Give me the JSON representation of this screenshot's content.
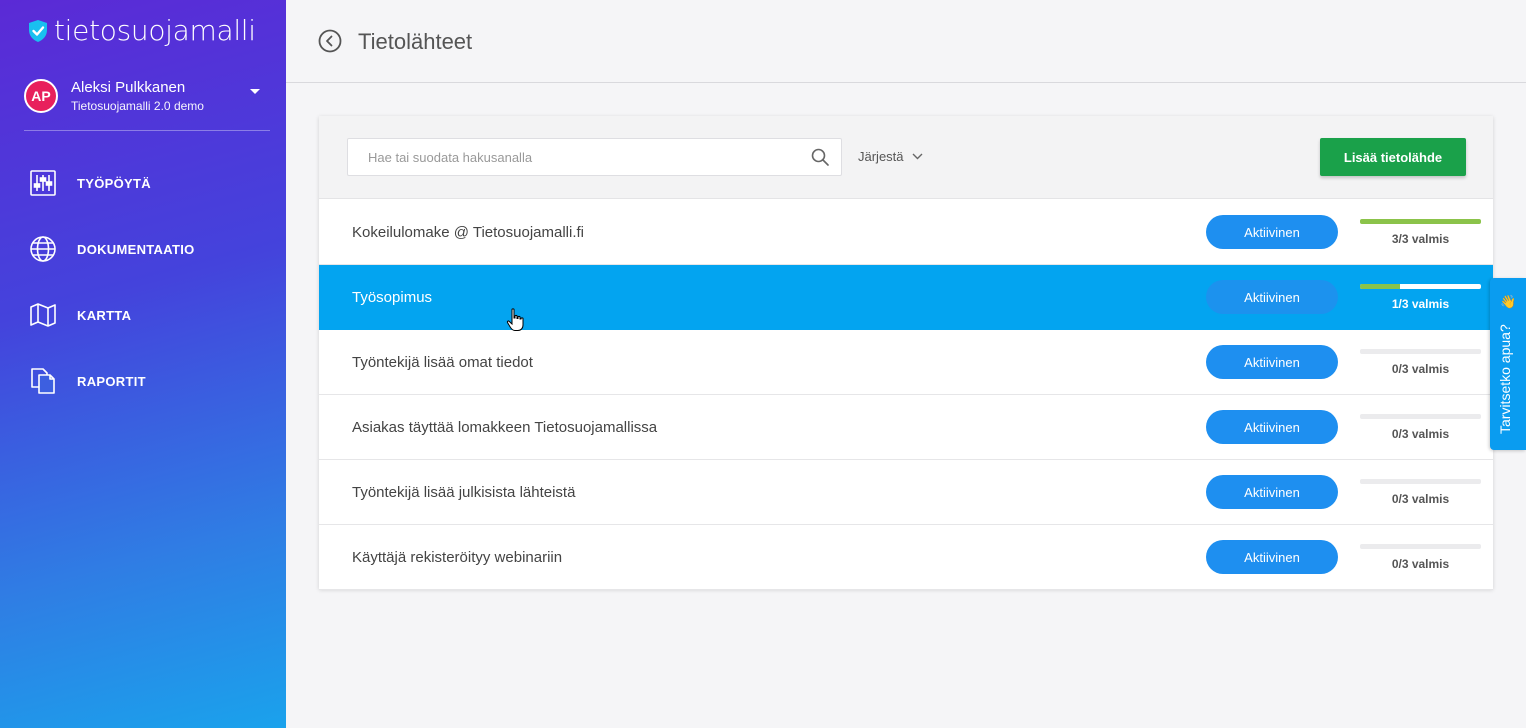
{
  "app": {
    "logo_text": "tietosuojamalli"
  },
  "user": {
    "initials": "AP",
    "name": "Aleksi Pulkkanen",
    "organization": "Tietosuojamalli 2.0 demo"
  },
  "nav": {
    "items": [
      {
        "label": "TYÖPÖYTÄ",
        "icon": "sliders-icon"
      },
      {
        "label": "DOKUMENTAATIO",
        "icon": "globe-icon"
      },
      {
        "label": "KARTTA",
        "icon": "map-icon"
      },
      {
        "label": "RAPORTIT",
        "icon": "documents-icon"
      }
    ]
  },
  "header": {
    "title": "Tietolähteet"
  },
  "toolbar": {
    "search_placeholder": "Hae tai suodata hakusanalla",
    "sort_label": "Järjestä",
    "add_label": "Lisää tietolähde"
  },
  "rows": [
    {
      "name": "Kokeilulomake @ Tietosuojamalli.fi",
      "status": "Aktiivinen",
      "progress_text": "3/3 valmis",
      "progress": 1.0,
      "selected": false
    },
    {
      "name": "Työsopimus",
      "status": "Aktiivinen",
      "progress_text": "1/3 valmis",
      "progress": 0.333,
      "selected": true
    },
    {
      "name": "Työntekijä lisää omat tiedot",
      "status": "Aktiivinen",
      "progress_text": "0/3 valmis",
      "progress": 0,
      "selected": false
    },
    {
      "name": "Asiakas täyttää lomakkeen Tietosuojamallissa",
      "status": "Aktiivinen",
      "progress_text": "0/3 valmis",
      "progress": 0,
      "selected": false
    },
    {
      "name": "Työntekijä lisää julkisista lähteistä",
      "status": "Aktiivinen",
      "progress_text": "0/3 valmis",
      "progress": 0,
      "selected": false
    },
    {
      "name": "Käyttäjä rekisteröityy webinariin",
      "status": "Aktiivinen",
      "progress_text": "0/3 valmis",
      "progress": 0,
      "selected": false
    }
  ],
  "help": {
    "label": "Tarvitsetko apua?",
    "icon": "waving-hand-icon"
  },
  "colors": {
    "sidebar_top": "#5b2ad6",
    "sidebar_bottom": "#1aa2ec",
    "selected_row": "#03a4f0",
    "status_button": "#1e8ff0",
    "add_button": "#1aa14a",
    "progress_fill": "#8bc34a",
    "avatar": "#e8205c"
  }
}
